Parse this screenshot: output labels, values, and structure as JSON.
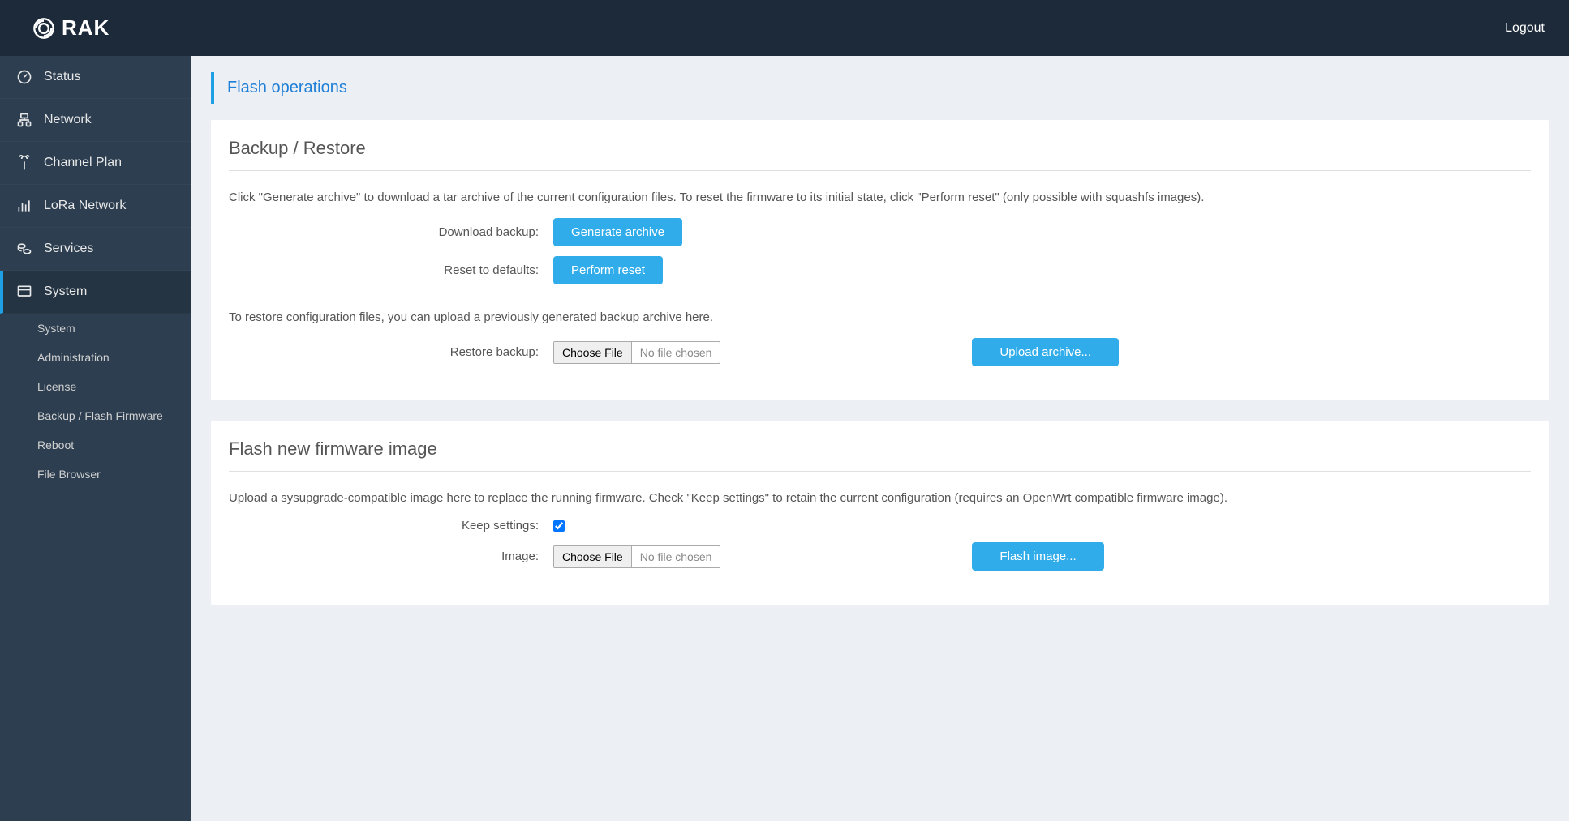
{
  "brand": "RAK",
  "header": {
    "logout": "Logout"
  },
  "nav": {
    "status": "Status",
    "network": "Network",
    "channel_plan": "Channel Plan",
    "lora": "LoRa Network",
    "services": "Services",
    "system": "System",
    "sub": {
      "system": "System",
      "administration": "Administration",
      "license": "License",
      "backup": "Backup / Flash Firmware",
      "reboot": "Reboot",
      "file_browser": "File Browser"
    }
  },
  "page": {
    "tab_title": "Flash operations",
    "backup": {
      "heading": "Backup / Restore",
      "desc1": "Click \"Generate archive\" to download a tar archive of the current configuration files. To reset the firmware to its initial state, click \"Perform reset\" (only possible with squashfs images).",
      "download_label": "Download backup:",
      "generate_btn": "Generate archive",
      "reset_label": "Reset to defaults:",
      "reset_btn": "Perform reset",
      "desc2": "To restore configuration files, you can upload a previously generated backup archive here.",
      "restore_label": "Restore backup:",
      "choose_file": "Choose File",
      "no_file": "No file chosen",
      "upload_btn": "Upload archive..."
    },
    "flash": {
      "heading": "Flash new firmware image",
      "desc": "Upload a sysupgrade-compatible image here to replace the running firmware. Check \"Keep settings\" to retain the current configuration (requires an OpenWrt compatible firmware image).",
      "keep_label": "Keep settings:",
      "image_label": "Image:",
      "choose_file": "Choose File",
      "no_file": "No file chosen",
      "flash_btn": "Flash image..."
    }
  }
}
